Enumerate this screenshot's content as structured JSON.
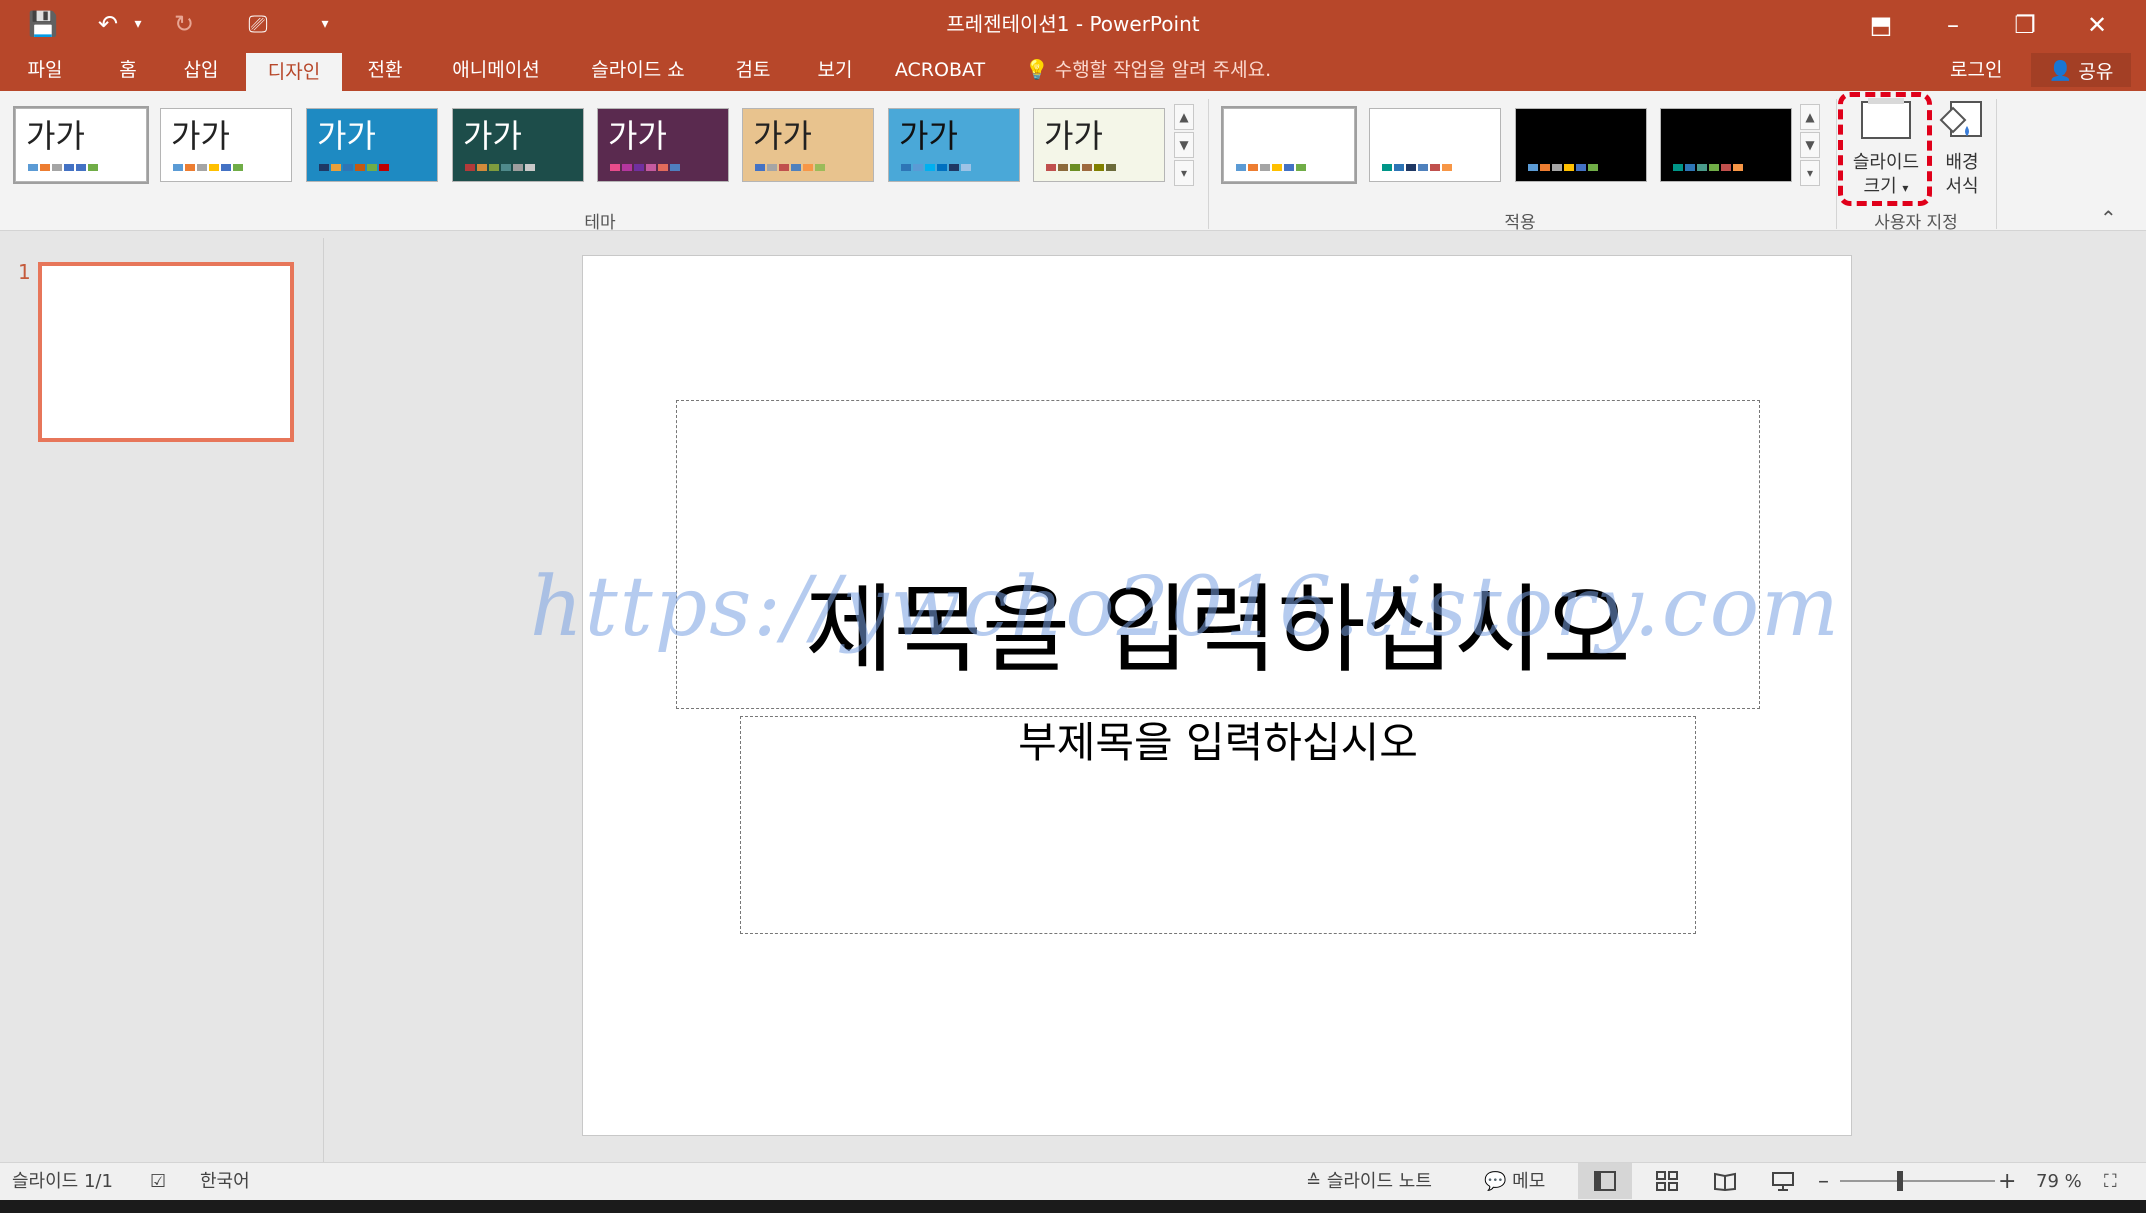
{
  "window": {
    "title": "프레젠테이션1 - PowerPoint",
    "qat": {
      "save": "💾",
      "undo": "↶",
      "undo_menu": "▾",
      "redo": "↻",
      "present": "⎚",
      "customize": "▾"
    },
    "controls": {
      "ribbon_display": "⬒",
      "minimize": "–",
      "restore": "❐",
      "close": "✕"
    }
  },
  "tabs": [
    {
      "label": "파일"
    },
    {
      "label": "홈"
    },
    {
      "label": "삽입"
    },
    {
      "label": "디자인"
    },
    {
      "label": "전환"
    },
    {
      "label": "애니메이션"
    },
    {
      "label": "슬라이드 쇼"
    },
    {
      "label": "검토"
    },
    {
      "label": "보기"
    },
    {
      "label": "ACROBAT"
    }
  ],
  "active_tab": "디자인",
  "tell_me": "수행할 작업을 알려 주세요.",
  "signin": "로그인",
  "share": "공유",
  "ribbon": {
    "themes_group_label": "테마",
    "variants_group_label": "적용",
    "customize_group_label": "사용자 지정",
    "theme_sample": "가가",
    "slide_size_label_1": "슬라이드",
    "slide_size_label_2": "크기",
    "slide_size_arrow": "▾",
    "format_bg_label_1": "배경",
    "format_bg_label_2": "서식",
    "collapse": "⌃",
    "scroll_up": "▲",
    "scroll_down": "▼",
    "scroll_more": "▾"
  },
  "themes": [
    {
      "label": "가가",
      "bg": "#ffffff",
      "fg": "#222222",
      "dots": [
        "#5b9bd5",
        "#ed7d31",
        "#a5a5a5",
        "#4472c4",
        "#4472c4",
        "#70ad47"
      ]
    },
    {
      "label": "가가",
      "bg": "#ffffff",
      "fg": "#222222",
      "dots": [
        "#5b9bd5",
        "#ed7d31",
        "#a5a5a5",
        "#ffc000",
        "#4472c4",
        "#70ad47"
      ]
    },
    {
      "label": "가가",
      "bg": "#1e8ac2",
      "fg": "#ffffff",
      "dots": [
        "#1f3864",
        "#e9a03b",
        "#2e75b6",
        "#c45911",
        "#70ad47",
        "#c00000"
      ]
    },
    {
      "label": "가가",
      "bg": "#1d4d4a",
      "fg": "#ffffff",
      "dots": [
        "#b33a3a",
        "#d28a3a",
        "#7f9c3e",
        "#4f8a8b",
        "#9e9e9e",
        "#c9c9c9"
      ]
    },
    {
      "label": "가가",
      "bg": "#5a2a4f",
      "fg": "#ffffff",
      "dots": [
        "#e84c8b",
        "#b4369e",
        "#7030a0",
        "#c55a9f",
        "#e26b5b",
        "#4f7fbf"
      ]
    },
    {
      "label": "가가",
      "bg": "#e8c38e",
      "fg": "#222222",
      "dots": [
        "#4472c4",
        "#a5a5a5",
        "#c0504d",
        "#4f81bd",
        "#f79646",
        "#9bbb59"
      ]
    },
    {
      "label": "가가",
      "bg": "#4aa8d8",
      "fg": "#111111",
      "dots": [
        "#2e75b6",
        "#5b9bd5",
        "#00b0f0",
        "#0070c0",
        "#1f3864",
        "#9dc3e6"
      ]
    },
    {
      "label": "가가",
      "bg": "#f4f6e8",
      "fg": "#222222",
      "dots": [
        "#c0504d",
        "#8c6a3b",
        "#6b8e23",
        "#9e6a3e",
        "#808000",
        "#6b6b3a"
      ]
    }
  ],
  "variants": [
    {
      "bg": "#ffffff",
      "dots": [
        "#5b9bd5",
        "#ed7d31",
        "#a5a5a5",
        "#ffc000",
        "#4472c4",
        "#70ad47"
      ]
    },
    {
      "bg": "#ffffff",
      "dots": [
        "#009688",
        "#2e75b6",
        "#1f3864",
        "#4f81bd",
        "#c0504d",
        "#f79646"
      ]
    },
    {
      "bg": "#000000",
      "dots": [
        "#5b9bd5",
        "#ed7d31",
        "#a5a5a5",
        "#ffc000",
        "#4472c4",
        "#70ad47"
      ]
    },
    {
      "bg": "#000000",
      "dots": [
        "#009688",
        "#2e75b6",
        "#4a9a8a",
        "#70ad47",
        "#c0504d",
        "#f79646"
      ]
    }
  ],
  "slides_pane": {
    "number": "1"
  },
  "slide": {
    "title_placeholder": "제목을 입력하십시오",
    "subtitle_placeholder": "부제목을 입력하십시오",
    "watermark": "https://ywcho2016.tistory.com"
  },
  "status": {
    "slide_counter": "슬라이드 1/1",
    "language": "한국어",
    "notes": "슬라이드 노트",
    "comments": "메모",
    "zoom_minus": "–",
    "zoom_plus": "+",
    "zoom": "79 %"
  },
  "colors": {
    "accent": "#b7472a",
    "highlight": "#e0001a",
    "selection": "#e7765a"
  }
}
